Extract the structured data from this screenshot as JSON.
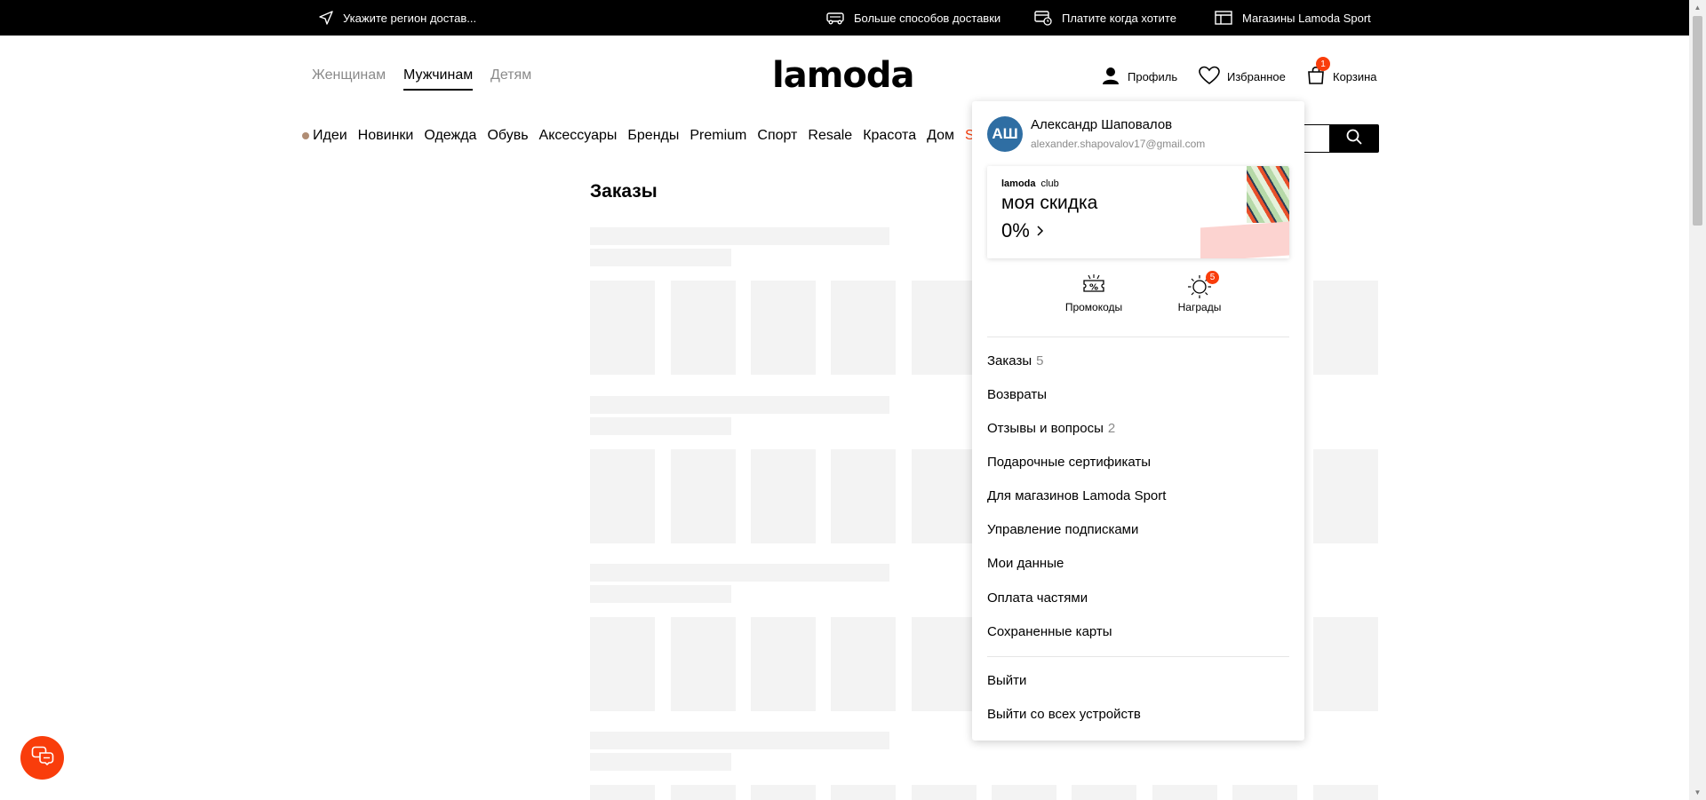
{
  "topbar": {
    "region": "Укажите регион достав...",
    "delivery": "Больше способов доставки",
    "pay_later": "Платите когда хотите",
    "stores": "Магазины Lamoda Sport"
  },
  "header": {
    "genders": [
      "Женщинам",
      "Мужчинам",
      "Детям"
    ],
    "active_gender": "Мужчинам",
    "logo": "lamoda",
    "profile": "Профиль",
    "favorites": "Избранное",
    "cart": "Корзина",
    "cart_count": "1"
  },
  "categories": [
    "Идеи",
    "Новинки",
    "Одежда",
    "Обувь",
    "Аксессуары",
    "Бренды",
    "Premium",
    "Спорт",
    "Resale",
    "Красота",
    "Дом",
    "Sa"
  ],
  "page": {
    "title": "Заказы"
  },
  "dropdown": {
    "avatar_initials": "АШ",
    "user_name": "Александр Шаповалов",
    "user_email": "alexander.shapovalov17@gmail.com",
    "club": {
      "brand": "lamoda",
      "brand_suffix": "club",
      "subtitle": "моя скидка",
      "discount": "0%"
    },
    "promocodes": "Промокоды",
    "rewards": "Награды",
    "rewards_count": "5",
    "menu": [
      {
        "label": "Заказы",
        "count": "5"
      },
      {
        "label": "Возвраты",
        "count": ""
      },
      {
        "label": "Отзывы и вопросы",
        "count": "2"
      },
      {
        "label": "Подарочные сертификаты",
        "count": ""
      },
      {
        "label": "Для магазинов Lamoda Sport",
        "count": ""
      },
      {
        "label": "Управление подписками",
        "count": ""
      },
      {
        "label": "Мои данные",
        "count": ""
      },
      {
        "label": "Оплата частями",
        "count": ""
      },
      {
        "label": "Сохраненные карты",
        "count": ""
      }
    ],
    "logout": "Выйти",
    "logout_all": "Выйти со всех устройств"
  },
  "colors": {
    "accent": "#f93d0b",
    "avatar": "#2f6ea3",
    "skeleton": "#f3f3f3"
  }
}
